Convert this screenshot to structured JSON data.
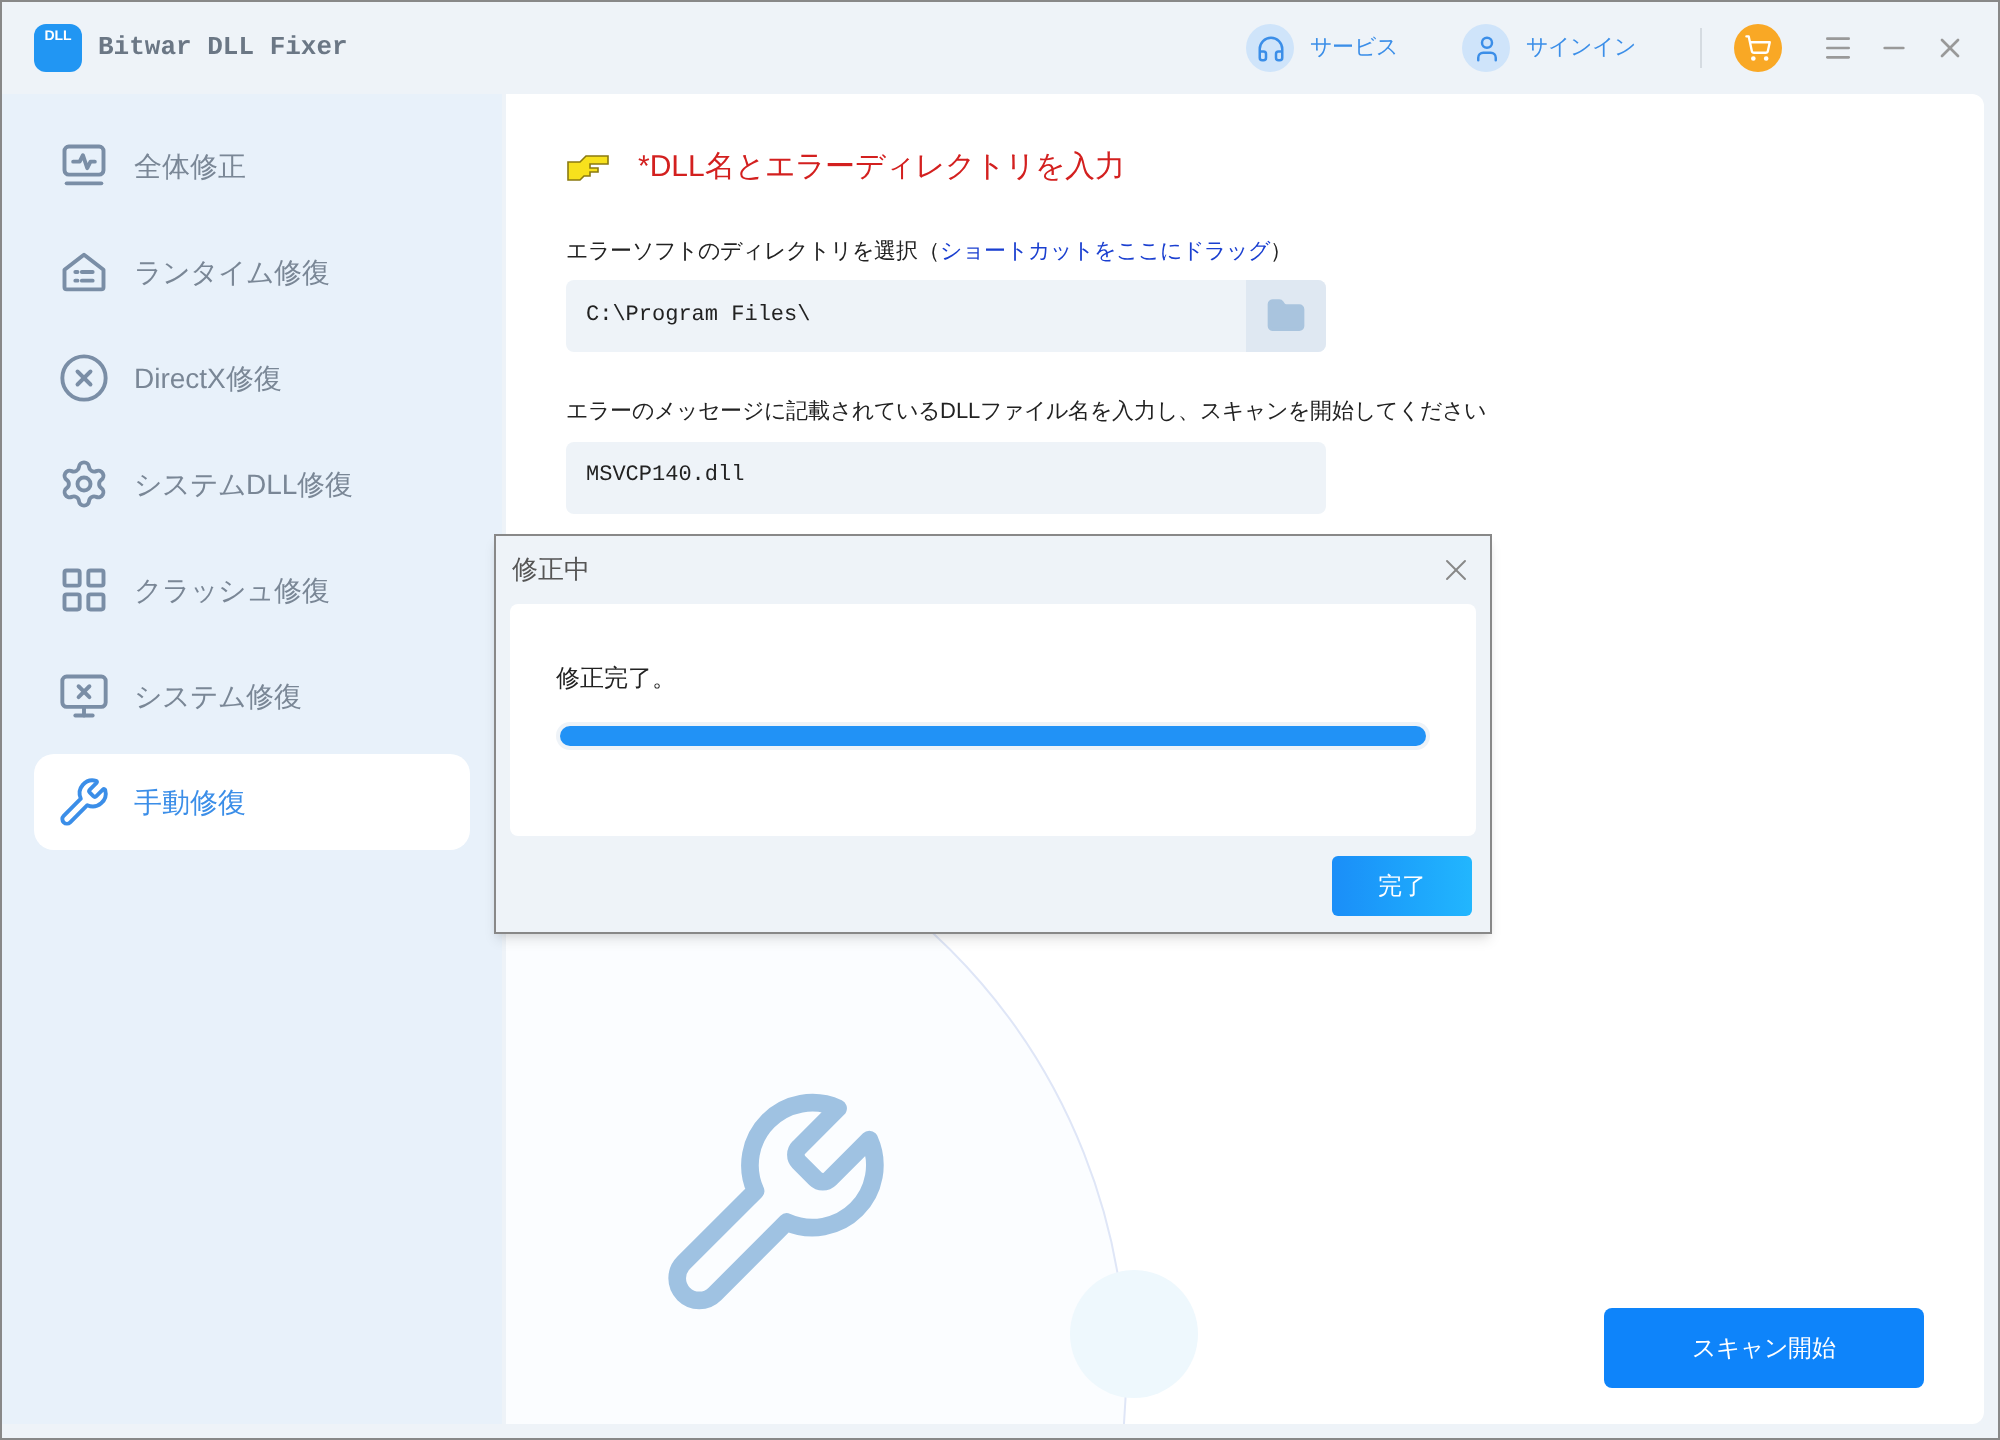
{
  "window": {
    "title": "Bitwar DLL Fixer",
    "logo": "DLL"
  },
  "header": {
    "links": [
      {
        "kind": "service",
        "label": "サービス"
      },
      {
        "kind": "user",
        "label": "サインイン"
      }
    ]
  },
  "sidebar": {
    "items": [
      {
        "kind": "monitor",
        "label": "全体修正",
        "selected": false
      },
      {
        "kind": "runtime",
        "label": "ランタイム修復",
        "selected": false
      },
      {
        "kind": "circle-x",
        "label": "DirectX修復",
        "selected": false
      },
      {
        "kind": "gear",
        "label": "システムDLL修復",
        "selected": false
      },
      {
        "kind": "grid",
        "label": "クラッシュ修復",
        "selected": false
      },
      {
        "kind": "monitor-x",
        "label": "システム修復",
        "selected": false
      },
      {
        "kind": "wrench",
        "label": "手動修復",
        "selected": true
      }
    ]
  },
  "main": {
    "heading": "*DLL名とエラーディレクトリを入力",
    "directory": {
      "label": "エラーソフトのディレクトリを選択（",
      "link": "ショートカットをここにドラッグ",
      "label_end": "）",
      "value": "C:\\Program Files\\"
    },
    "dll": {
      "label": "エラーのメッセージに記載されているDLLファイル名を入力し、スキャンを開始してください",
      "value": "MSVCP140.dll"
    },
    "scan_button": "スキャン開始"
  },
  "dialog": {
    "title": "修正中",
    "message": "修正完了。",
    "progress": {
      "level": 1
    },
    "button": "完了"
  }
}
